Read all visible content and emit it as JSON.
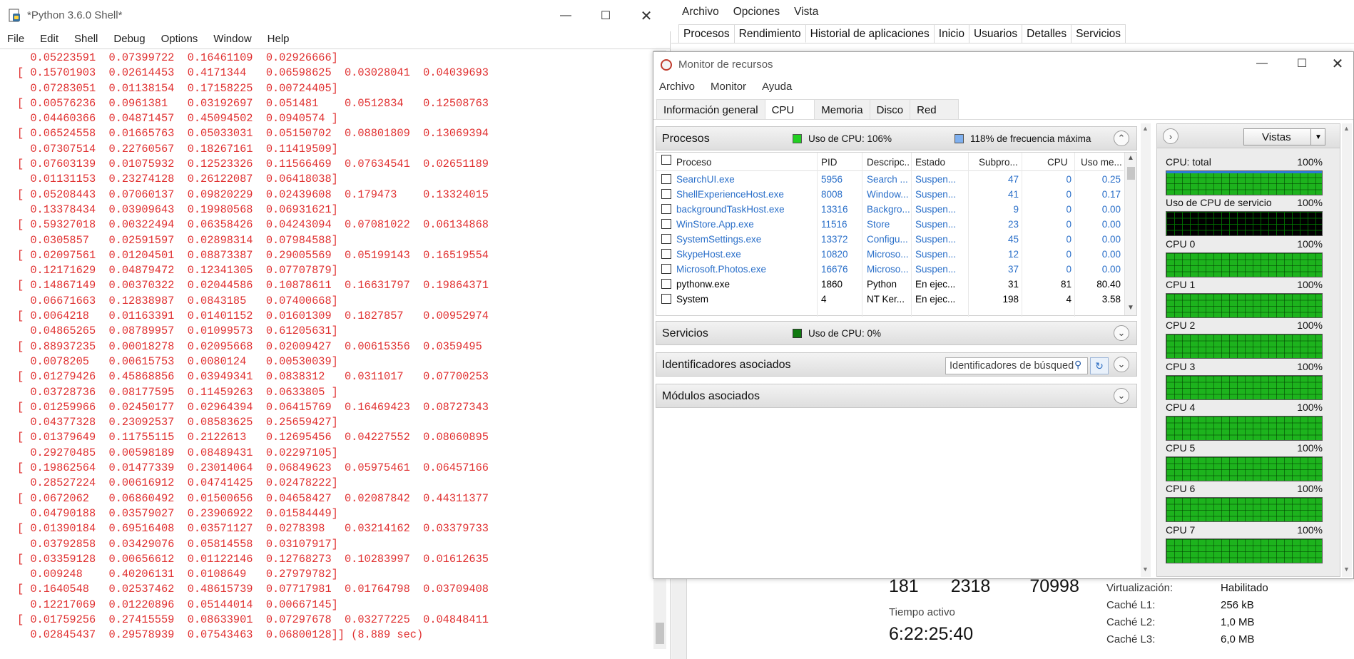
{
  "idle": {
    "title": "*Python 3.6.0 Shell*",
    "menu": [
      "File",
      "Edit",
      "Shell",
      "Debug",
      "Options",
      "Window",
      "Help"
    ],
    "output_lines": [
      "  0.05223591  0.07399722  0.16461109  0.02926666]",
      "[ 0.15701903  0.02614453  0.4171344   0.06598625  0.03028041  0.04039693",
      "  0.07283051  0.01138154  0.17158225  0.00724405]",
      "[ 0.00576236  0.0961381   0.03192697  0.051481    0.0512834   0.12508763",
      "  0.04460366  0.04871457  0.45094502  0.0940574 ]",
      "[ 0.06524558  0.01665763  0.05033031  0.05150702  0.08801809  0.13069394",
      "  0.07307514  0.22760567  0.18267161  0.11419509]",
      "[ 0.07603139  0.01075932  0.12523326  0.11566469  0.07634541  0.02651189",
      "  0.01131153  0.23274128  0.26122087  0.06418038]",
      "[ 0.05208443  0.07060137  0.09820229  0.02439608  0.179473    0.13324015",
      "  0.13378434  0.03909643  0.19980568  0.06931621]",
      "[ 0.59327018  0.00322494  0.06358426  0.04243094  0.07081022  0.06134868",
      "  0.0305857   0.02591597  0.02898314  0.07984588]",
      "[ 0.02097561  0.01204501  0.08873387  0.29005569  0.05199143  0.16519554",
      "  0.12171629  0.04879472  0.12341305  0.07707879]",
      "[ 0.14867149  0.00370322  0.02044586  0.10878611  0.16631797  0.19864371",
      "  0.06671663  0.12838987  0.0843185   0.07400668]",
      "[ 0.0064218   0.01163391  0.01401152  0.01601309  0.1827857   0.00952974",
      "  0.04865265  0.08789957  0.01099573  0.61205631]",
      "[ 0.88937235  0.00018278  0.02095668  0.02009427  0.00615356  0.0359495",
      "  0.0078205   0.00615753  0.0080124   0.00530039]",
      "[ 0.01279426  0.45868856  0.03949341  0.0838312   0.0311017   0.07700253",
      "  0.03728736  0.08177595  0.11459263  0.0633805 ]",
      "[ 0.01259966  0.02450177  0.02964394  0.06415769  0.16469423  0.08727343",
      "  0.04377328  0.23092537  0.08583625  0.25659427]",
      "[ 0.01379649  0.11755115  0.2122613   0.12695456  0.04227552  0.08060895",
      "  0.29270485  0.00598189  0.08489431  0.02297105]",
      "[ 0.19862564  0.01477339  0.23014064  0.06849623  0.05975461  0.06457166",
      "  0.28527224  0.00616912  0.04741425  0.02478222]",
      "[ 0.0672062   0.06860492  0.01500656  0.04658427  0.02087842  0.44311377",
      "  0.04790188  0.03579027  0.23906922  0.01584449]",
      "[ 0.01390184  0.69516408  0.03571127  0.0278398   0.03214162  0.03379733",
      "  0.03792858  0.03429076  0.05814558  0.03107917]",
      "[ 0.03359128  0.00656612  0.01122146  0.12768273  0.10283997  0.01612635",
      "  0.009248    0.40206131  0.0108649   0.27979782]",
      "[ 0.1640548   0.02537462  0.48615739  0.07717981  0.01764798  0.03709408",
      "  0.12217069  0.01220896  0.05144014  0.00667145]",
      "[ 0.01759256  0.27415559  0.08633901  0.07297678  0.03277225  0.04848411",
      "  0.02845437  0.29578939  0.07543463  0.06800128]] (8.889 sec)"
    ]
  },
  "task_manager": {
    "menu": [
      "Archivo",
      "Opciones",
      "Vista"
    ],
    "tabs": [
      "Procesos",
      "Rendimiento",
      "Historial de aplicaciones",
      "Inicio",
      "Usuarios",
      "Detalles",
      "Servicios"
    ],
    "selected_tab": "Rendimiento",
    "stats": [
      "181",
      "2318",
      "70998"
    ],
    "uptime_label": "Tiempo activo",
    "uptime": "6:22:25:40",
    "specs": [
      {
        "label": "Virtualización:",
        "value": "Habilitado"
      },
      {
        "label": "Caché L1:",
        "value": "256 kB"
      },
      {
        "label": "Caché L2:",
        "value": "1,0 MB"
      },
      {
        "label": "Caché L3:",
        "value": "6,0 MB"
      }
    ]
  },
  "resource_monitor": {
    "title": "Monitor de recursos",
    "menu": [
      "Archivo",
      "Monitor",
      "Ayuda"
    ],
    "tabs": [
      "Información general",
      "CPU",
      "Memoria",
      "Disco",
      "Red"
    ],
    "selected_tab": "CPU",
    "processes": {
      "title": "Procesos",
      "cpu_usage": "Uso de CPU: 106%",
      "max_freq": "118% de frecuencia máxima",
      "cpu_color": "#22d022",
      "freq_color": "#7fb0ef",
      "columns": [
        "Proceso",
        "PID",
        "Descripc...",
        "Estado",
        "Subpro...",
        "CPU",
        "Uso me..."
      ],
      "rows": [
        {
          "name": "SearchUI.exe",
          "pid": "5956",
          "desc": "Search ...",
          "state": "Suspen...",
          "threads": "47",
          "cpu": "0",
          "avg": "0.25",
          "suspended": true
        },
        {
          "name": "ShellExperienceHost.exe",
          "pid": "8008",
          "desc": "Window...",
          "state": "Suspen...",
          "threads": "41",
          "cpu": "0",
          "avg": "0.17",
          "suspended": true
        },
        {
          "name": "backgroundTaskHost.exe",
          "pid": "13316",
          "desc": "Backgro...",
          "state": "Suspen...",
          "threads": "9",
          "cpu": "0",
          "avg": "0.00",
          "suspended": true
        },
        {
          "name": "WinStore.App.exe",
          "pid": "11516",
          "desc": "Store",
          "state": "Suspen...",
          "threads": "23",
          "cpu": "0",
          "avg": "0.00",
          "suspended": true
        },
        {
          "name": "SystemSettings.exe",
          "pid": "13372",
          "desc": "Configu...",
          "state": "Suspen...",
          "threads": "45",
          "cpu": "0",
          "avg": "0.00",
          "suspended": true
        },
        {
          "name": "SkypeHost.exe",
          "pid": "10820",
          "desc": "Microso...",
          "state": "Suspen...",
          "threads": "12",
          "cpu": "0",
          "avg": "0.00",
          "suspended": true
        },
        {
          "name": "Microsoft.Photos.exe",
          "pid": "16676",
          "desc": "Microso...",
          "state": "Suspen...",
          "threads": "37",
          "cpu": "0",
          "avg": "0.00",
          "suspended": true
        },
        {
          "name": "pythonw.exe",
          "pid": "1860",
          "desc": "Python",
          "state": "En ejec...",
          "threads": "31",
          "cpu": "81",
          "avg": "80.40",
          "suspended": false
        },
        {
          "name": "System",
          "pid": "4",
          "desc": "NT Ker...",
          "state": "En ejec...",
          "threads": "198",
          "cpu": "4",
          "avg": "3.58",
          "suspended": false
        }
      ]
    },
    "services": {
      "title": "Servicios",
      "cpu_usage": "Uso de CPU: 0%",
      "color": "#0f7a0f"
    },
    "handles": {
      "title": "Identificadores asociados",
      "search_placeholder": "Identificadores de búsqueda"
    },
    "modules": {
      "title": "Módulos asociados"
    },
    "views_label": "Vistas",
    "graphs": [
      {
        "label": "CPU: total",
        "value": "100%",
        "state": "full-blue"
      },
      {
        "label": "Uso de CPU de servicio",
        "value": "100%",
        "state": "empty"
      },
      {
        "label": "CPU 0",
        "value": "100%",
        "state": "full"
      },
      {
        "label": "CPU 1",
        "value": "100%",
        "state": "full"
      },
      {
        "label": "CPU 2",
        "value": "100%",
        "state": "full"
      },
      {
        "label": "CPU 3",
        "value": "100%",
        "state": "full"
      },
      {
        "label": "CPU 4",
        "value": "100%",
        "state": "full"
      },
      {
        "label": "CPU 5",
        "value": "100%",
        "state": "full"
      },
      {
        "label": "CPU 6",
        "value": "100%",
        "state": "full"
      },
      {
        "label": "CPU 7",
        "value": "100%",
        "state": "full"
      }
    ]
  }
}
